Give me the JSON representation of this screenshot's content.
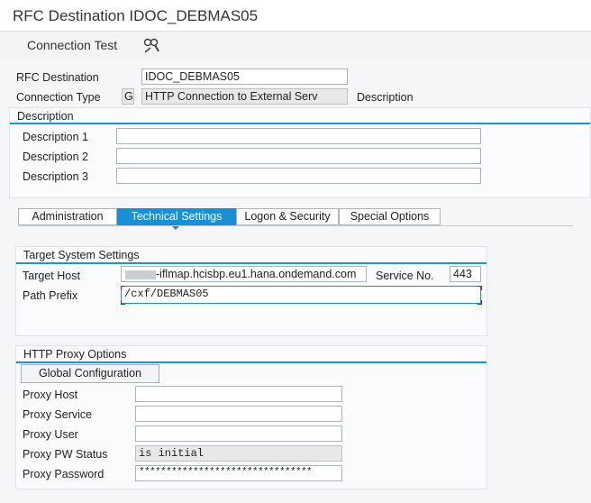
{
  "title": "RFC Destination IDOC_DEBMAS05",
  "toolbar": {
    "connection_test": "Connection Test",
    "icon": "glasses-magnifier-icon"
  },
  "header": {
    "rfc_destination_label": "RFC Destination",
    "rfc_destination_value": "IDOC_DEBMAS05",
    "connection_type_label": "Connection Type",
    "connection_type_code": "G",
    "connection_type_text": "HTTP Connection to External Serv",
    "description_label": "Description"
  },
  "description_section": {
    "title": "Description",
    "rows": [
      {
        "label": "Description 1",
        "value": ""
      },
      {
        "label": "Description 2",
        "value": ""
      },
      {
        "label": "Description 3",
        "value": ""
      }
    ]
  },
  "tabs": [
    {
      "label": "Administration",
      "active": false
    },
    {
      "label": "Technical Settings",
      "active": true
    },
    {
      "label": "Logon & Security",
      "active": false
    },
    {
      "label": "Special Options",
      "active": false
    }
  ],
  "target_system": {
    "title": "Target System Settings",
    "target_host_label": "Target Host",
    "target_host_value": "-iflmap.hcisbp.eu1.hana.ondemand.com",
    "service_no_label": "Service No.",
    "service_no_value": "443",
    "path_prefix_label": "Path Prefix",
    "path_prefix_value": "/cxf/DEBMAS05"
  },
  "proxy": {
    "title": "HTTP Proxy Options",
    "global_config_button": "Global Configuration",
    "host_label": "Proxy Host",
    "host_value": "",
    "service_label": "Proxy Service",
    "service_value": "",
    "user_label": "Proxy User",
    "user_value": "",
    "pw_status_label": "Proxy PW Status",
    "pw_status_value": "is initial",
    "password_label": "Proxy Password",
    "password_value": "********************************"
  },
  "colors": {
    "accent": "#1b8fd3",
    "focus_marker": "#d0021b"
  }
}
